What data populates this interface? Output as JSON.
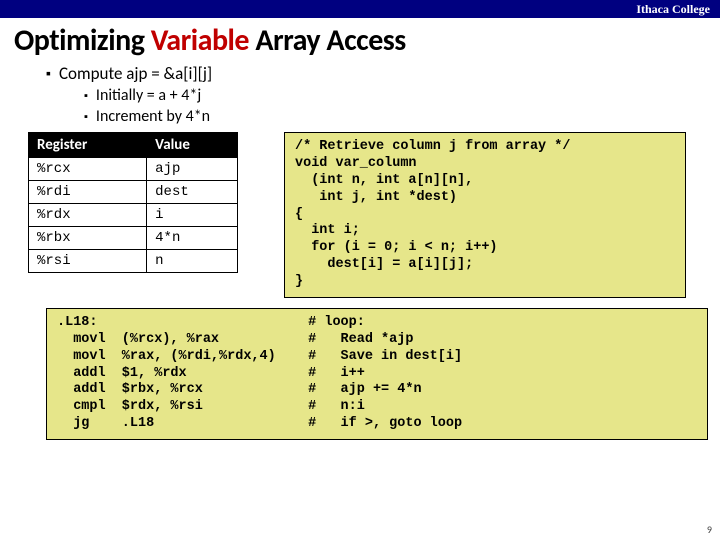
{
  "header": {
    "college": "Ithaca College"
  },
  "title": {
    "pre": "Optimizing ",
    "red": "Variable",
    "post": " Array Access"
  },
  "bullets": {
    "b1": "Compute ajp = &a[i][j]",
    "b2a": "Initially = a + 4*j",
    "b2b": "Increment by 4*n"
  },
  "table": {
    "h1": "Register",
    "h2": "Value",
    "rows": [
      {
        "r": "%rcx",
        "v": "ajp"
      },
      {
        "r": "%rdi",
        "v": "dest"
      },
      {
        "r": "%rdx",
        "v": "i"
      },
      {
        "r": "%rbx",
        "v": "4*n"
      },
      {
        "r": "%rsi",
        "v": "n"
      }
    ]
  },
  "code_c": "/* Retrieve column j from array */\nvoid var_column\n  (int n, int a[n][n],\n   int j, int *dest)\n{\n  int i;\n  for (i = 0; i < n; i++)\n    dest[i] = a[i][j];\n}",
  "code_asm": ".L18:                          # loop:\n  movl  (%rcx), %rax           #   Read *ajp\n  movl  %rax, (%rdi,%rdx,4)    #   Save in dest[i]\n  addl  $1, %rdx               #   i++\n  addl  $rbx, %rcx             #   ajp += 4*n\n  cmpl  $rdx, %rsi             #   n:i\n  jg    .L18                   #   if >, goto loop",
  "pagenum": "9"
}
